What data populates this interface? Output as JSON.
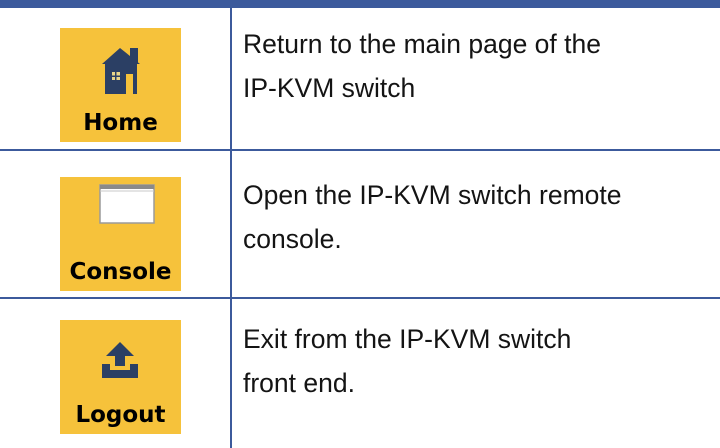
{
  "rows": [
    {
      "button_label": "Home",
      "icon": "home-icon",
      "description": [
        "Return to the main page of the",
        "IP-KVM switch"
      ]
    },
    {
      "button_label": "Console",
      "icon": "console-window-icon",
      "description": [
        "Open the IP-KVM switch remote",
        "console."
      ]
    },
    {
      "button_label": "Logout",
      "icon": "logout-icon",
      "description": [
        "Exit from the IP-KVM switch",
        "front end."
      ]
    }
  ],
  "colors": {
    "rule": "#3c5a9c",
    "button_bg": "#f6c23b",
    "text": "#141414"
  }
}
